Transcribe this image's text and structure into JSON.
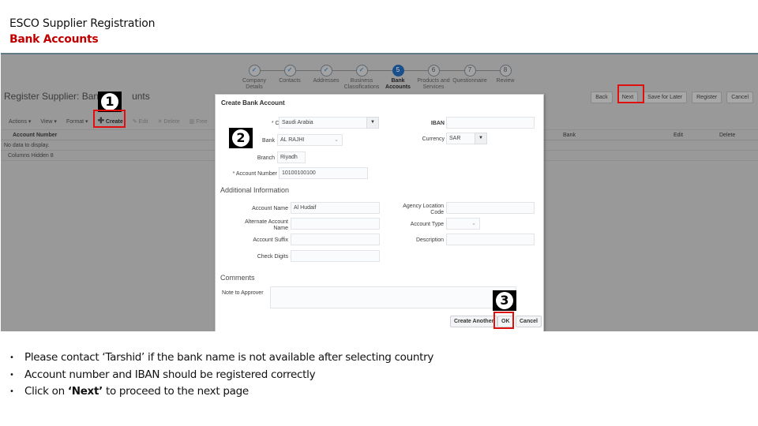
{
  "slide": {
    "title": "ESCO Supplier  Registration",
    "subtitle": "Bank Accounts"
  },
  "train": {
    "steps": [
      {
        "num": "✓",
        "label": "Company Details",
        "state": "done"
      },
      {
        "num": "✓",
        "label": "Contacts",
        "state": "done"
      },
      {
        "num": "✓",
        "label": "Addresses",
        "state": "done"
      },
      {
        "num": "✓",
        "label": "Business Classifications",
        "state": "done"
      },
      {
        "num": "5",
        "label": "Bank Accounts",
        "state": "active"
      },
      {
        "num": "6",
        "label": "Products and Services",
        "state": "todo"
      },
      {
        "num": "7",
        "label": "Questionnaire",
        "state": "todo"
      },
      {
        "num": "8",
        "label": "Review",
        "state": "todo"
      }
    ]
  },
  "page": {
    "title": "Register Supplier: Bank Accounts",
    "title_visible": "Register Supplier: Bank",
    "title_tail": "unts",
    "toolbar": {
      "actions": "Actions ▾",
      "view": "View ▾",
      "format": "Format ▾",
      "create": "Create",
      "edit": "Edit",
      "delete": "Delete",
      "freeze": "Free"
    },
    "columns": {
      "account_number": "Account Number",
      "bank": "Bank",
      "edit": "Edit",
      "delete": "Delete"
    },
    "no_data": "No data to display.",
    "columns_hidden": "Columns Hidden  8",
    "buttons": {
      "back": "Back",
      "next": "Next",
      "save_for_later": "Save for Later",
      "register": "Register",
      "cancel": "Cancel"
    }
  },
  "dialog": {
    "title": "Create Bank Account",
    "fields": {
      "country": {
        "label": "Country",
        "value": "Saudi Arabia",
        "required": true
      },
      "bank": {
        "label": "Bank",
        "value": "AL RAJHI"
      },
      "branch": {
        "label": "Branch",
        "value": "Riyadh"
      },
      "account_number": {
        "label": "Account Number",
        "value": "10100100100",
        "required": true
      },
      "iban": {
        "label": "IBAN",
        "value": ""
      },
      "currency": {
        "label": "Currency",
        "value": "SAR"
      }
    },
    "additional_info": {
      "heading": "Additional Information",
      "account_name": {
        "label": "Account Name",
        "value": "Al Hudaif"
      },
      "alternate_account_name": {
        "label": "Alternate Account Name",
        "value": ""
      },
      "account_suffix": {
        "label": "Account Suffix",
        "value": ""
      },
      "check_digits": {
        "label": "Check Digits",
        "value": ""
      },
      "agency_location_code": {
        "label": "Agency Location Code",
        "value": ""
      },
      "account_type": {
        "label": "Account Type",
        "value": ""
      },
      "description": {
        "label": "Description",
        "value": ""
      }
    },
    "comments": {
      "heading": "Comments",
      "note_to_approver": {
        "label": "Note to Approver",
        "value": ""
      }
    },
    "buttons": {
      "create_another": "Create Another",
      "ok": "OK",
      "cancel": "Cancel"
    }
  },
  "callouts": [
    "1",
    "2",
    "3"
  ],
  "notes": {
    "n1": "Please contact ‘Tarshid’ if the bank name is not available after selecting country",
    "n2": "Account number and IBAN should be registered correctly",
    "n3_pre": "Click on ",
    "n3_bold": "‘Next’",
    "n3_post": " to proceed to the next page"
  },
  "colors": {
    "accent_red": "#c00000",
    "highlight_red": "#e01010",
    "active_step": "#1a4f8a",
    "overlay_gray": "#999999"
  }
}
